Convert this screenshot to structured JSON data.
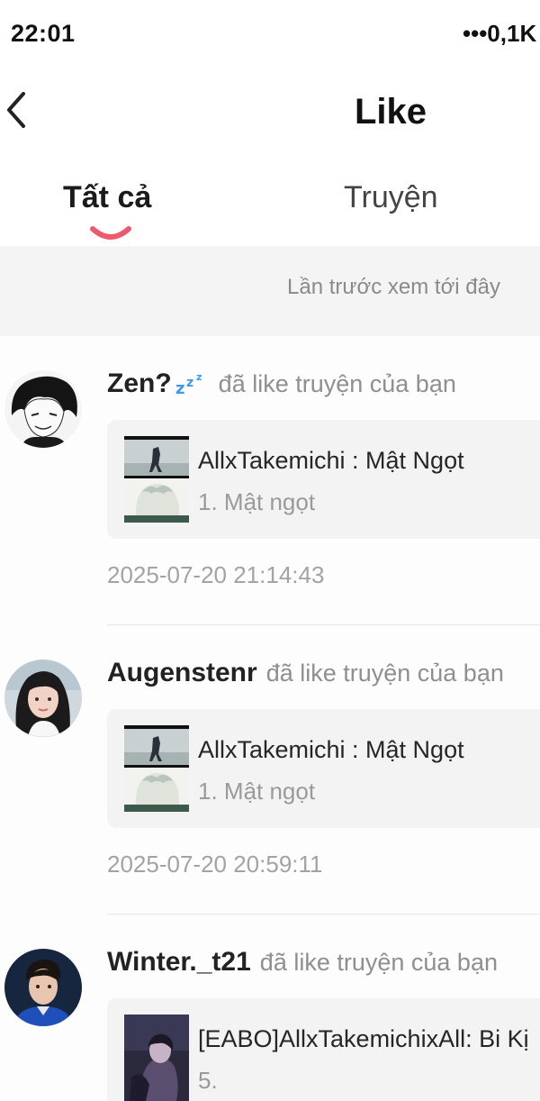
{
  "status_bar": {
    "time": "22:01",
    "network_text": "•••0,1K"
  },
  "header": {
    "title": "Like",
    "back_icon": "chevron-left-icon"
  },
  "tabs": [
    {
      "label": "Tất cả",
      "active": true
    },
    {
      "label": "Truyện",
      "active": false
    }
  ],
  "accent_color": "#f0586e",
  "last_seen_text": "Lần trước xem tới đây",
  "feed": [
    {
      "user": "Zen?",
      "user_emoji": "sleeping-zz-icon",
      "action": "đã like truyện của bạn",
      "story_title": "AllxTakemichi : Mật Ngọt",
      "chapter": "1. Mật ngọt",
      "timestamp": "2025-07-20 21:14:43"
    },
    {
      "user": "Augenstenr",
      "action": "đã like truyện của bạn",
      "story_title": "AllxTakemichi : Mật Ngọt",
      "chapter": "1. Mật ngọt",
      "timestamp": "2025-07-20 20:59:11"
    },
    {
      "user": "Winter._t21",
      "action": "đã like truyện của bạn",
      "story_title": "[EABO]AllxTakemichixAll: Bi Kị",
      "chapter": "5."
    }
  ]
}
